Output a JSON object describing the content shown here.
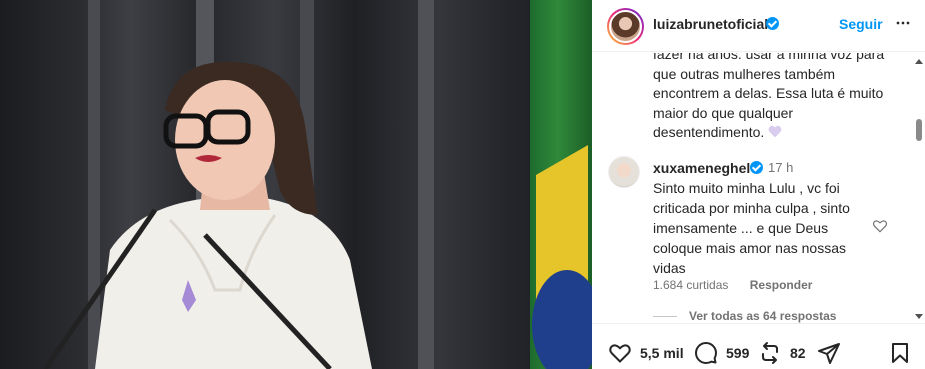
{
  "post": {
    "username": "luizabrunetoficial",
    "follow_label": "Seguir",
    "caption_lines": [
      "fazer há anos: usar a minha voz para",
      "que outras mulheres também",
      "encontrem a delas. Essa luta é muito",
      "maior do que qualquer",
      "desentendimento."
    ],
    "caption_emoji": "purple-heart-icon"
  },
  "comment": {
    "username": "xuxameneghel",
    "time": "17 h",
    "text": "Sinto muito minha Lulu , vc foi criticada por minha culpa , sinto imensamente ... e que Deus coloque mais amor nas nossas vidas",
    "likes": "1.684 curtidas",
    "reply_label": "Responder",
    "view_replies": "Ver todas as 64 respostas"
  },
  "actions": {
    "likes": "5,5 mil",
    "comments": "599",
    "reposts": "82"
  },
  "colors": {
    "accent": "#0095f6",
    "text": "#262626",
    "secondary": "#737373"
  }
}
